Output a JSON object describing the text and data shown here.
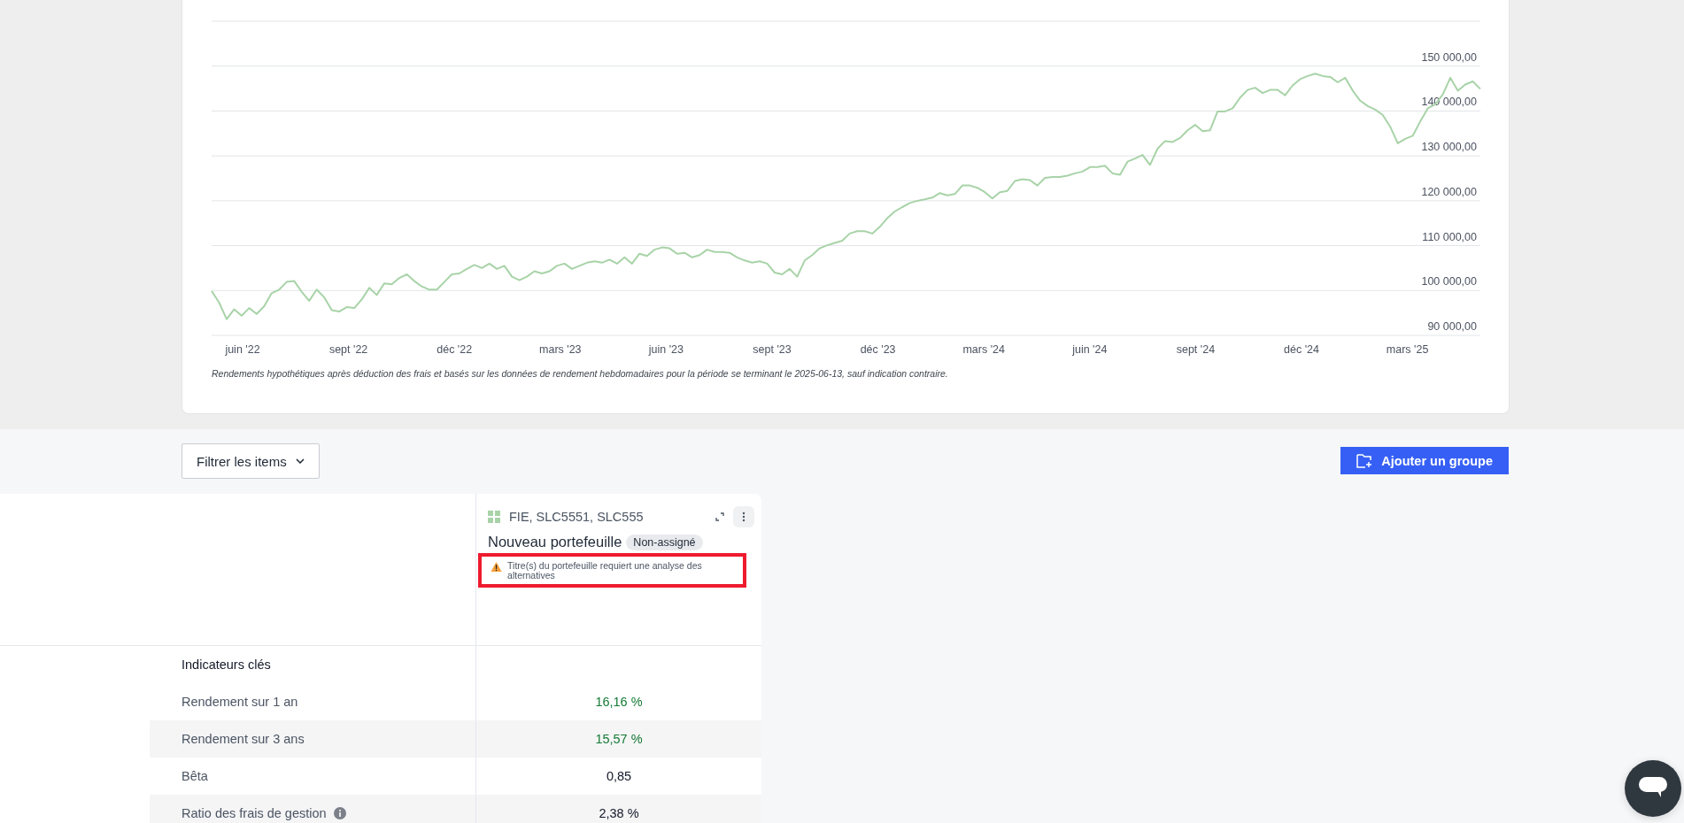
{
  "chart": {
    "chart_data": {
      "type": "line",
      "series": [
        {
          "color": "#a8d3a8",
          "values": [
            99900,
            97300,
            93600,
            95800,
            94400,
            96100,
            94800,
            96500,
            99400,
            100200,
            101900,
            102100,
            99700,
            97700,
            100200,
            98500,
            95600,
            95300,
            96300,
            96100,
            98000,
            100600,
            99000,
            101600,
            101400,
            102800,
            103600,
            102100,
            100900,
            100200,
            100200,
            101900,
            103600,
            103800,
            104800,
            105700,
            105000,
            106000,
            104800,
            105500,
            103100,
            102300,
            103100,
            104300,
            103800,
            104300,
            105500,
            106000,
            104800,
            105500,
            106200,
            106500,
            106200,
            106900,
            106000,
            107400,
            106000,
            108200,
            107700,
            109100,
            109600,
            109400,
            108200,
            108400,
            107400,
            107900,
            109100,
            108600,
            108600,
            108400,
            107400,
            106700,
            106200,
            106500,
            106000,
            104000,
            103600,
            104800,
            103100,
            106700,
            107900,
            109400,
            110100,
            110600,
            111100,
            112700,
            113200,
            113200,
            112700,
            114200,
            116100,
            117600,
            118600,
            119500,
            120000,
            120300,
            120700,
            121700,
            121200,
            121500,
            123400,
            123400,
            122900,
            121900,
            120500,
            121900,
            122200,
            124400,
            124800,
            124600,
            123400,
            125100,
            125300,
            125300,
            125600,
            126100,
            126500,
            127500,
            127500,
            127800,
            126100,
            125800,
            128700,
            129400,
            130200,
            128000,
            131600,
            133300,
            133100,
            134000,
            135700,
            136900,
            135500,
            135700,
            139900,
            139900,
            140600,
            143000,
            144700,
            145200,
            144000,
            144700,
            144700,
            143500,
            145700,
            147100,
            147800,
            148300,
            147800,
            147600,
            146400,
            147400,
            144500,
            142300,
            141100,
            140300,
            139100,
            136500,
            132800,
            133800,
            134500,
            137700,
            140600,
            141500,
            143700,
            147400,
            144500,
            145900,
            146600,
            144900
          ]
        }
      ],
      "ylim": [
        90000,
        160000
      ],
      "yticks": [
        {
          "value": 90000,
          "label": "90 000,00"
        },
        {
          "value": 100000,
          "label": "100 000,00"
        },
        {
          "value": 110000,
          "label": "110 000,00"
        },
        {
          "value": 120000,
          "label": "120 000,00"
        },
        {
          "value": 130000,
          "label": "130 000,00"
        },
        {
          "value": 140000,
          "label": "140 000,00"
        },
        {
          "value": 150000,
          "label": "150 000,00"
        }
      ],
      "grid": true
    },
    "x_axis_labels": [
      "juin '22",
      "sept '22",
      "déc '22",
      "mars '23",
      "juin '23",
      "sept '23",
      "déc '23",
      "mars '24",
      "juin '24",
      "sept '24",
      "déc '24",
      "mars '25"
    ],
    "caption": "Rendements hypothétiques après déduction des frais et basés sur les données de rendement hebdomadaires pour la période se terminant le 2025-06-13, sauf indication contraire."
  },
  "toolbar": {
    "filter_button": "Filtrer les items",
    "add_group_button": "Ajouter un groupe"
  },
  "portfolio_card": {
    "tickers": "FIE, SLC5551, SLC555",
    "name": "Nouveau portefeuille",
    "badge": "Non-assigné",
    "warning": "Titre(s) du portefeuille requiert une analyse des alternatives",
    "warning_highlighted": true
  },
  "metrics": {
    "section": "Indicateurs clés",
    "rows": [
      {
        "label": "Rendement sur 1 an",
        "value": "16,16 %",
        "positive": true,
        "info": false
      },
      {
        "label": "Rendement sur 3 ans",
        "value": "15,57 %",
        "positive": true,
        "info": false
      },
      {
        "label": "Bêta",
        "value": "0,85",
        "positive": false,
        "info": false
      },
      {
        "label": "Ratio des frais de gestion",
        "value": "2,38 %",
        "positive": false,
        "info": true
      }
    ]
  }
}
